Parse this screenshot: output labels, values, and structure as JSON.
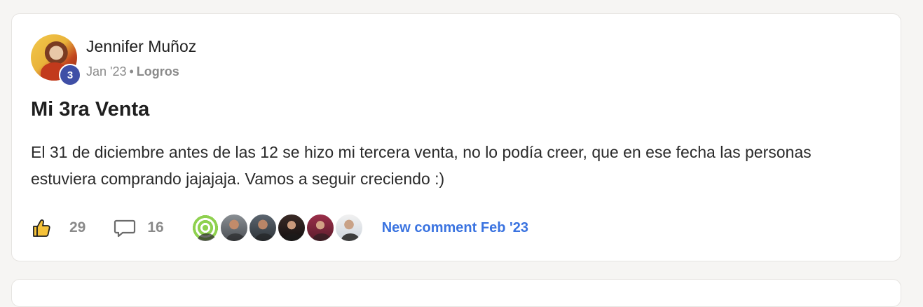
{
  "post": {
    "author": {
      "name": "Jennifer Muñoz",
      "level": "3"
    },
    "meta": {
      "date": "Jan '23",
      "separator": "•",
      "category": "Logros"
    },
    "title": "Mi 3ra Venta",
    "body": "El 31 de diciembre antes de las 12 se hizo mi tercera venta, no lo podía creer, que en ese fecha las personas estuviera comprando jajajaja. Vamos a seguir creciendo :)",
    "footer": {
      "likes": "29",
      "comments": "16",
      "like_icon": "thumbs-up-icon",
      "comment_icon": "comment-icon",
      "new_comment_label": "New comment Feb '23"
    }
  },
  "colors": {
    "badge": "#3f4fa6",
    "link": "#3a73e0",
    "muted": "#8a8a8a",
    "background": "#f6f5f3"
  }
}
